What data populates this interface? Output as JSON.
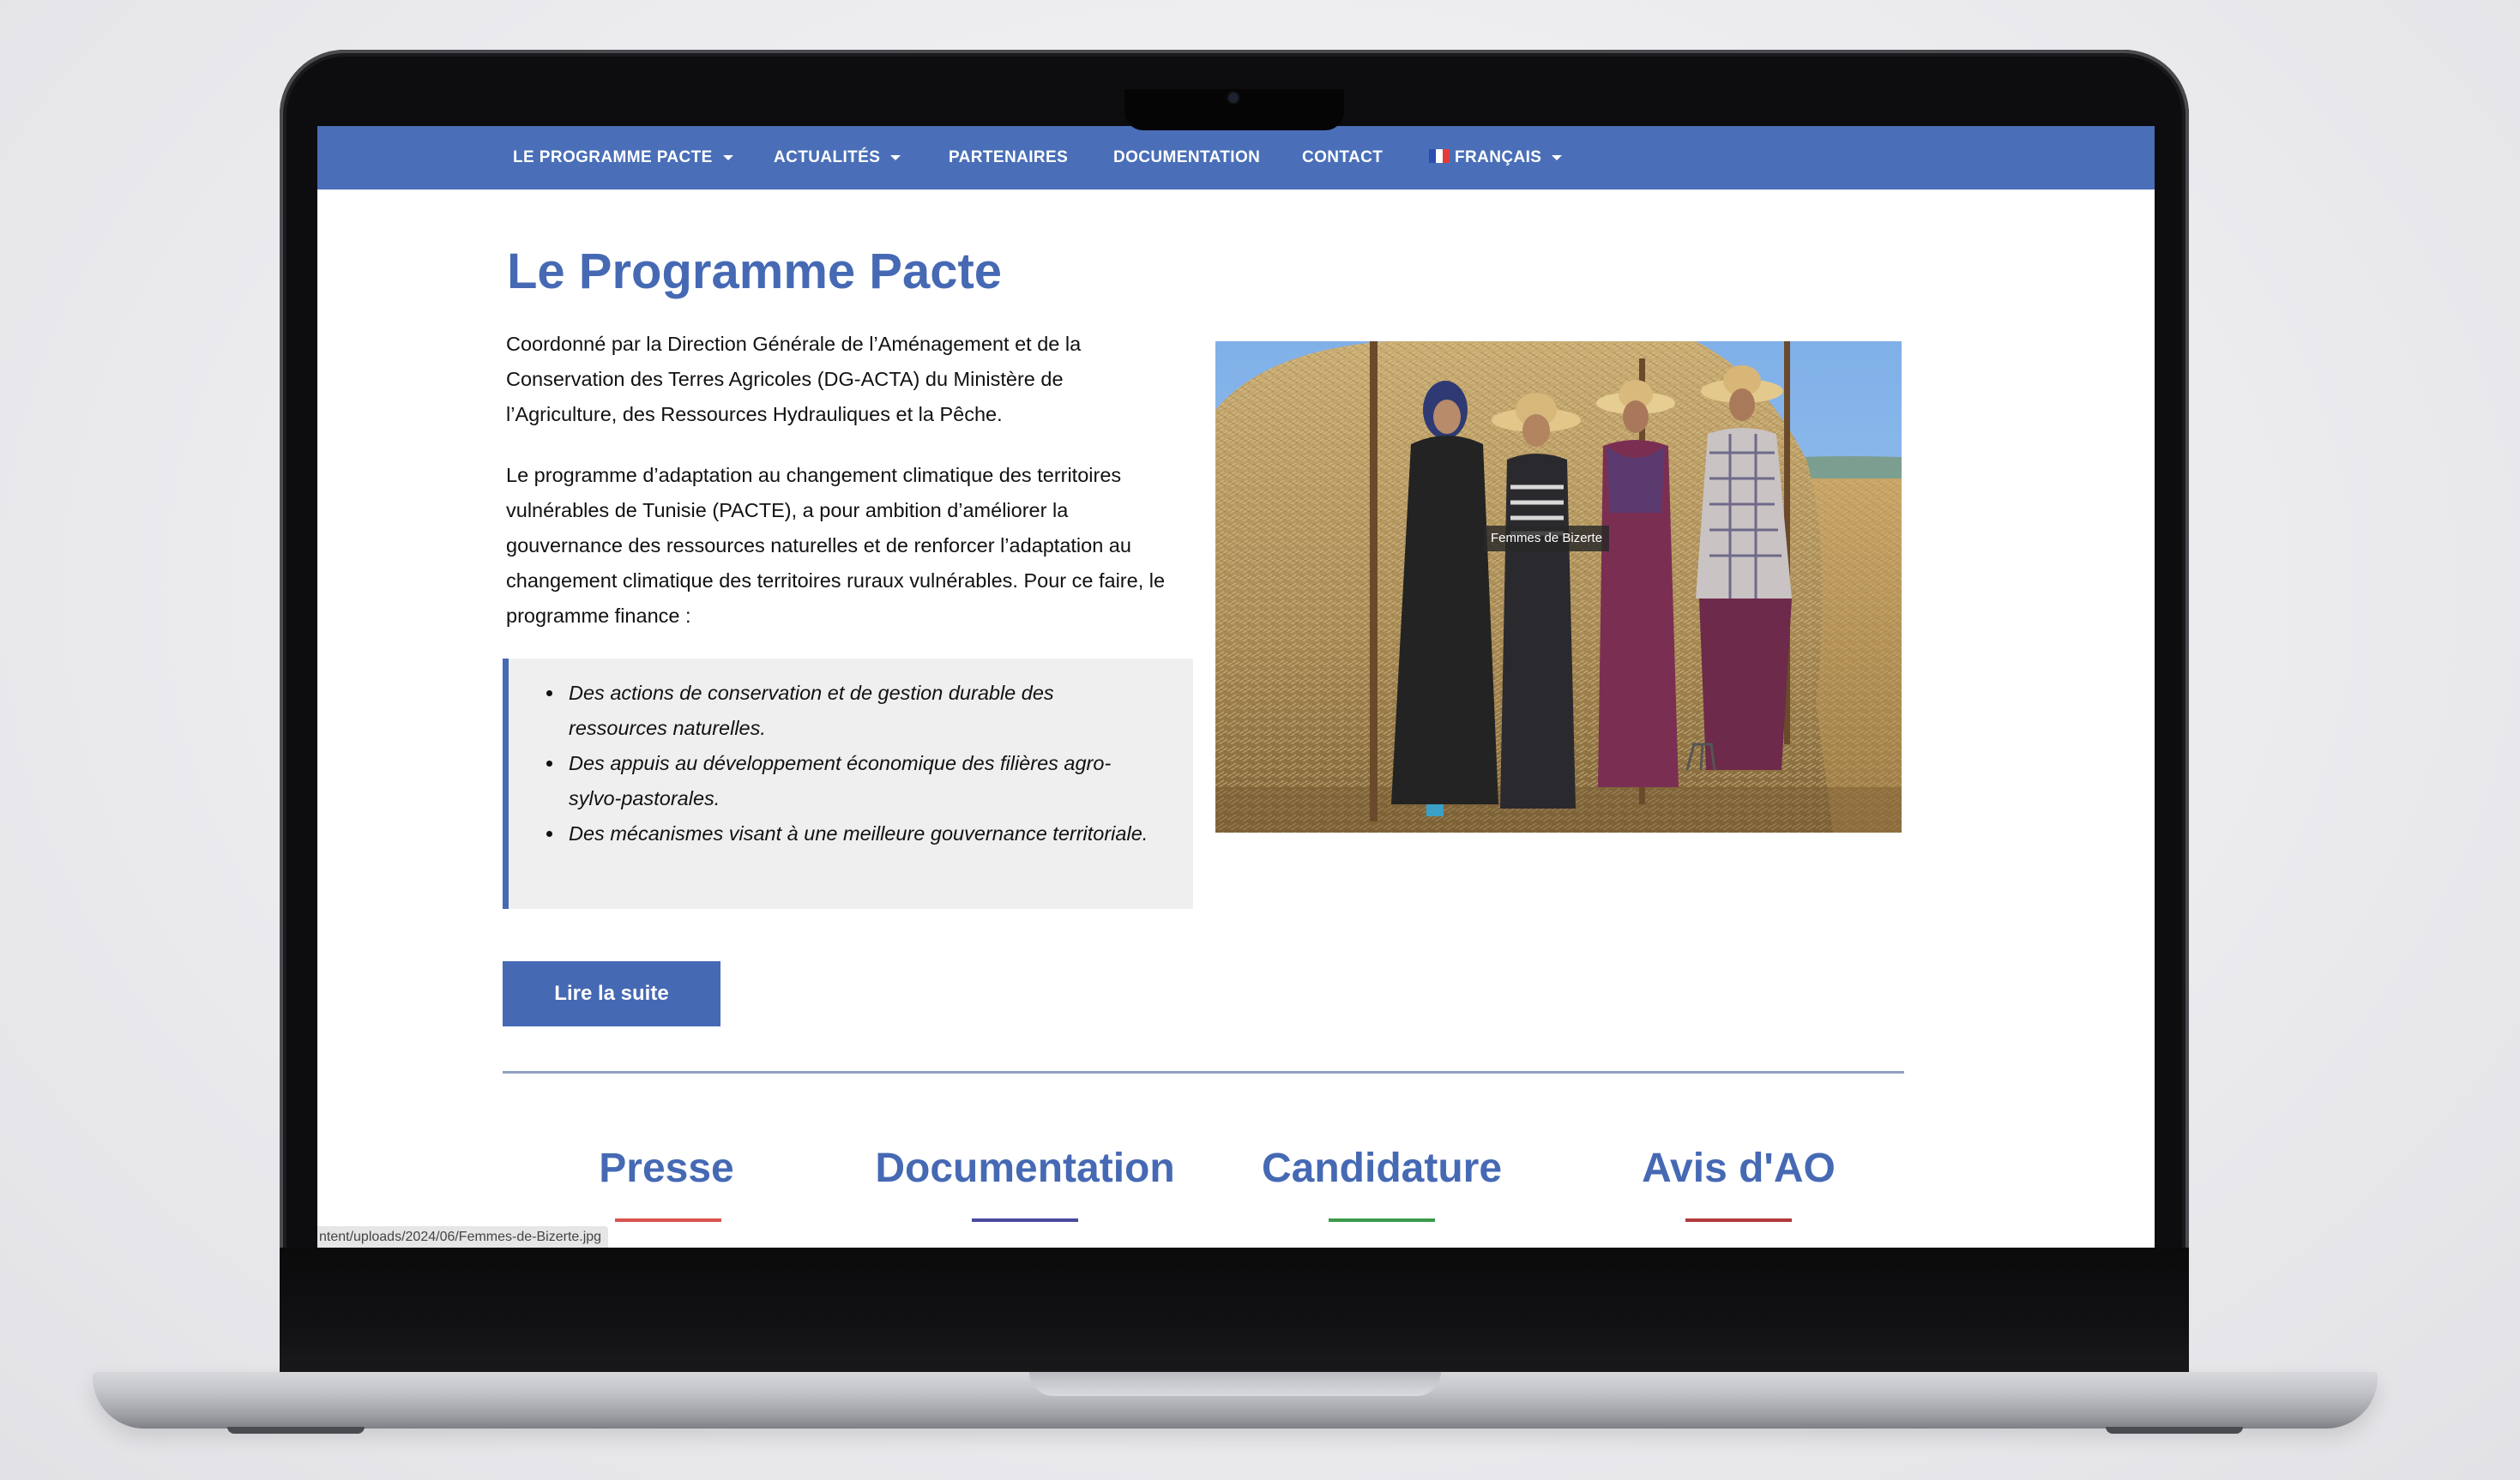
{
  "nav": {
    "items": [
      {
        "label": "LE PROGRAMME PACTE",
        "has_dropdown": true
      },
      {
        "label": "ACTUALITÉS",
        "has_dropdown": true
      },
      {
        "label": "PARTENAIRES",
        "has_dropdown": false
      },
      {
        "label": "DOCUMENTATION",
        "has_dropdown": false
      },
      {
        "label": "CONTACT",
        "has_dropdown": false
      },
      {
        "label": "FRANÇAIS",
        "has_dropdown": true,
        "icon": "french-flag-icon"
      }
    ]
  },
  "main": {
    "title": "Le Programme Pacte",
    "paragraph1": "Coordonné par la Direction Générale de l’Aménagement et de la Conservation des Terres Agricoles (DG-ACTA) du Ministère de l’Agriculture, des Ressources Hydrauliques et la Pêche.",
    "paragraph2": "Le programme d’adaptation au changement climatique des territoires vulnérables de Tunisie (PACTE), a pour ambition d’améliorer la gouvernance des ressources naturelles et de renforcer l’adaptation au changement climatique des territoires ruraux vulnérables. Pour ce faire, le programme finance :",
    "bullets": [
      "Des actions de conservation et de gestion durable des ressources naturelles.",
      "Des appuis au développement économique des filières agro-sylvo-pastorales.",
      "Des mécanismes visant à une meilleure gouvernance territoriale."
    ],
    "image_caption": "Femmes de Bizerte",
    "read_more_label": "Lire la suite"
  },
  "sections": [
    {
      "label": "Presse",
      "color": "#d9534f"
    },
    {
      "label": "Documentation",
      "color": "#4a4aa0"
    },
    {
      "label": "Candidature",
      "color": "#3a9a4a"
    },
    {
      "label": "Avis d'AO",
      "color": "#b03a3a"
    }
  ],
  "status_bar": {
    "url": "ntent/uploads/2024/06/Femmes-de-Bizerte.jpg"
  },
  "colors": {
    "nav_background": "#4a6fb8",
    "accent": "#4669b4"
  }
}
